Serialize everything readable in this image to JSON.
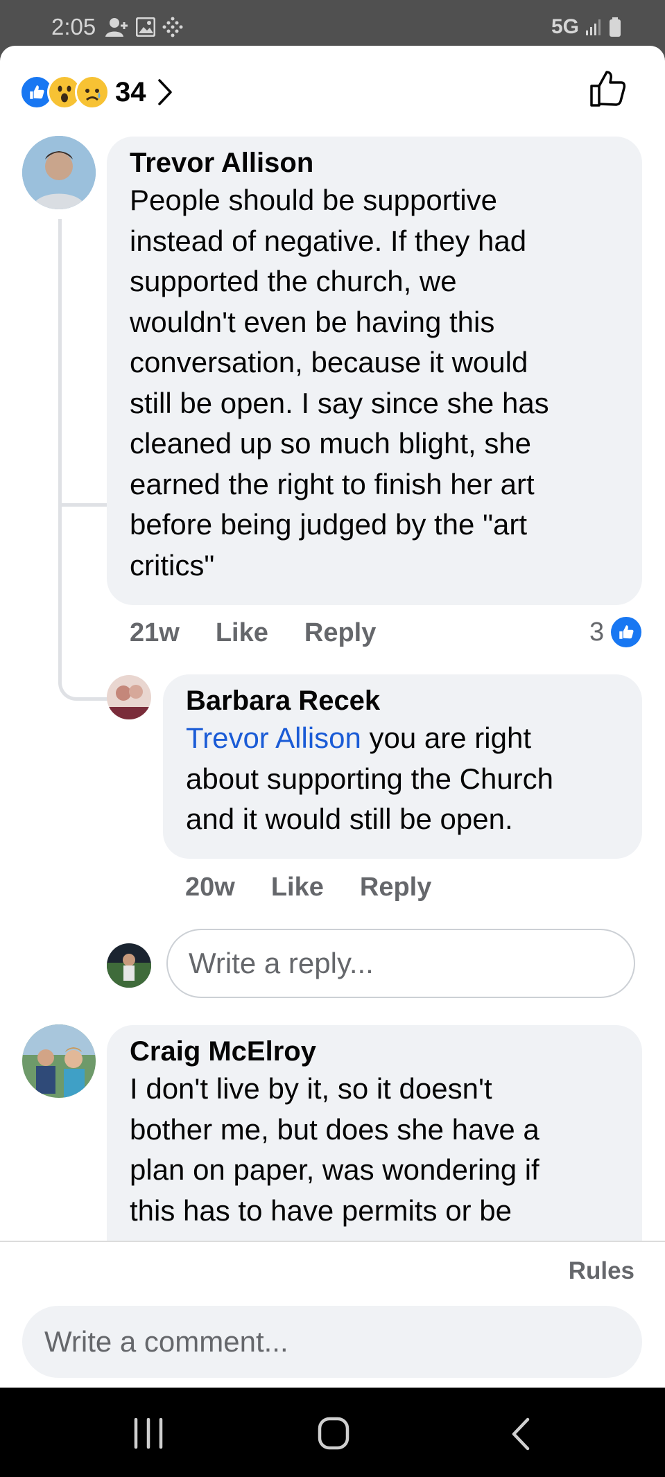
{
  "status_bar": {
    "time": "2:05",
    "network": "5G"
  },
  "reactions": {
    "count": "34"
  },
  "comments": [
    {
      "author": "Trevor Allison",
      "lines": [
        "People should be supportive",
        "instead of negative. If they had",
        "supported the church, we",
        "wouldn't even be having this",
        "conversation, because it would",
        "still be open.  I say since she has",
        "cleaned up so much blight, she",
        "earned the right to finish her art",
        "before being judged by the \"art",
        "critics\""
      ],
      "age": "21w",
      "like": "Like",
      "reply": "Reply",
      "like_count": "3"
    },
    {
      "author": "Craig McElroy",
      "lines": [
        "I don't live by it, so it doesn't",
        "bother me, but does she have a",
        "plan on paper, was wondering if",
        "this has to have permits or be"
      ]
    }
  ],
  "reply": {
    "author": "Barbara Recek",
    "mention": "Trevor Allison",
    "line1_rest": " you are right",
    "lines": [
      "about supporting the Church",
      "and it would still be open."
    ],
    "age": "20w",
    "like": "Like",
    "reply": "Reply"
  },
  "reply_input": {
    "placeholder": "Write a reply..."
  },
  "footer": {
    "rules": "Rules",
    "comment_placeholder": "Write a comment..."
  },
  "colors": {
    "like_blue": "#1877f2",
    "mention_blue": "#1a5bd6",
    "bubble": "#f0f2f5",
    "meta_gray": "#65676b"
  }
}
